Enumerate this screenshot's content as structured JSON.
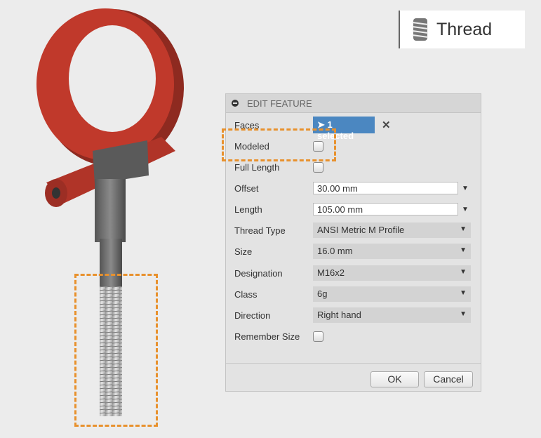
{
  "tool_badge": {
    "label": "Thread",
    "icon": "thread-icon"
  },
  "dialog": {
    "title": "EDIT FEATURE",
    "faces": {
      "label": "Faces",
      "value": "1 selected"
    },
    "modeled": {
      "label": "Modeled",
      "checked": false
    },
    "full_length": {
      "label": "Full Length",
      "checked": false
    },
    "offset": {
      "label": "Offset",
      "value": "30.00 mm"
    },
    "length": {
      "label": "Length",
      "value": "105.00 mm"
    },
    "thread_type": {
      "label": "Thread Type",
      "value": "ANSI Metric M Profile"
    },
    "size": {
      "label": "Size",
      "value": "16.0 mm"
    },
    "designation": {
      "label": "Designation",
      "value": "M16x2"
    },
    "class": {
      "label": "Class",
      "value": "6g"
    },
    "direction": {
      "label": "Direction",
      "value": "Right hand"
    },
    "remember_size": {
      "label": "Remember Size",
      "checked": false
    },
    "ok": "OK",
    "cancel": "Cancel"
  },
  "colors": {
    "highlight": "#e8912d",
    "selection": "#4b87c1",
    "hook": "#c0392b"
  }
}
